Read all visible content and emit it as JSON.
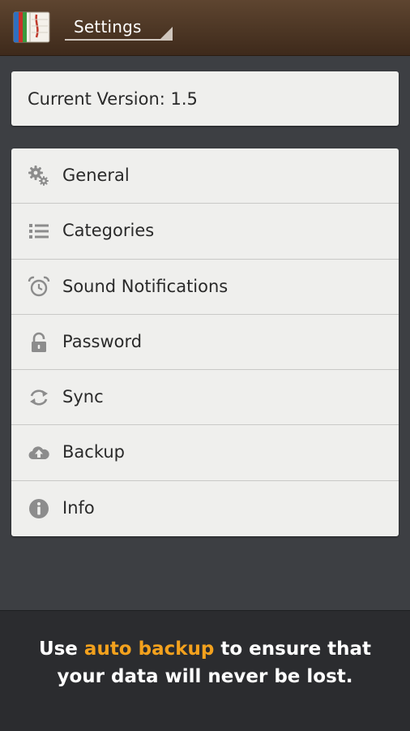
{
  "actionbar": {
    "title": "Settings"
  },
  "version": {
    "text": "Current Version: 1.5"
  },
  "menu": {
    "items": [
      {
        "label": "General",
        "icon": "gears-icon"
      },
      {
        "label": "Categories",
        "icon": "list-icon"
      },
      {
        "label": "Sound Notifications",
        "icon": "alarm-clock-icon"
      },
      {
        "label": "Password",
        "icon": "lock-icon"
      },
      {
        "label": "Sync",
        "icon": "sync-icon"
      },
      {
        "label": "Backup",
        "icon": "cloud-upload-icon"
      },
      {
        "label": "Info",
        "icon": "info-icon"
      }
    ]
  },
  "banner": {
    "pre": "Use ",
    "highlight": "auto backup",
    "post": " to ensure that your data will never be lost."
  },
  "colors": {
    "actionbar": "#4e3826",
    "background": "#3d3f43",
    "card": "#efefed",
    "highlight": "#f3a11d"
  }
}
